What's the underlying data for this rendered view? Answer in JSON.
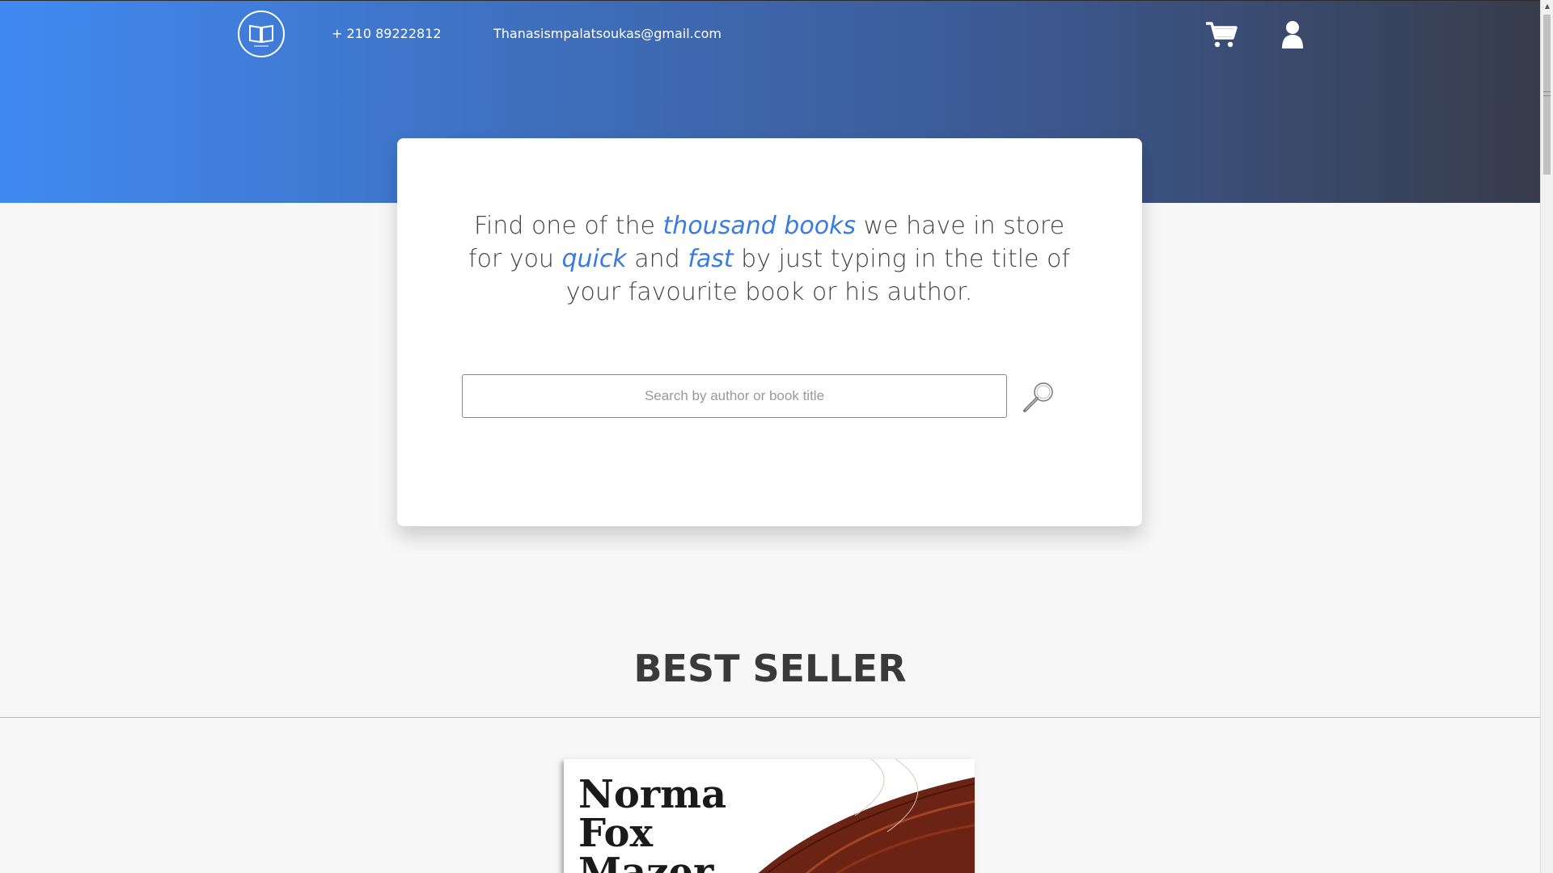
{
  "header": {
    "logo_icon": "open-book-icon",
    "phone": "+ 210 89222812",
    "email": "Thanasismpalatsoukas@gmail.com",
    "cart_icon": "shopping-cart-icon",
    "user_icon": "user-icon",
    "gradient_colors": [
      "#4189f2",
      "#373c4a"
    ]
  },
  "search_card": {
    "tagline": {
      "part1": "Find one of the ",
      "highlight1": "thousand books",
      "part2": " we have in store for you ",
      "highlight2": "quick",
      "part3": " and ",
      "highlight3": "fast",
      "part4": " by just typing in the title of your favourite book or his author."
    },
    "search_placeholder": "Search by author or book title",
    "search_icon": "magnifier-icon",
    "accent_color": "#3a7be0"
  },
  "best_seller": {
    "title": "BEST SELLER",
    "book_cover_text": "Norma\nFox\nMazer"
  }
}
